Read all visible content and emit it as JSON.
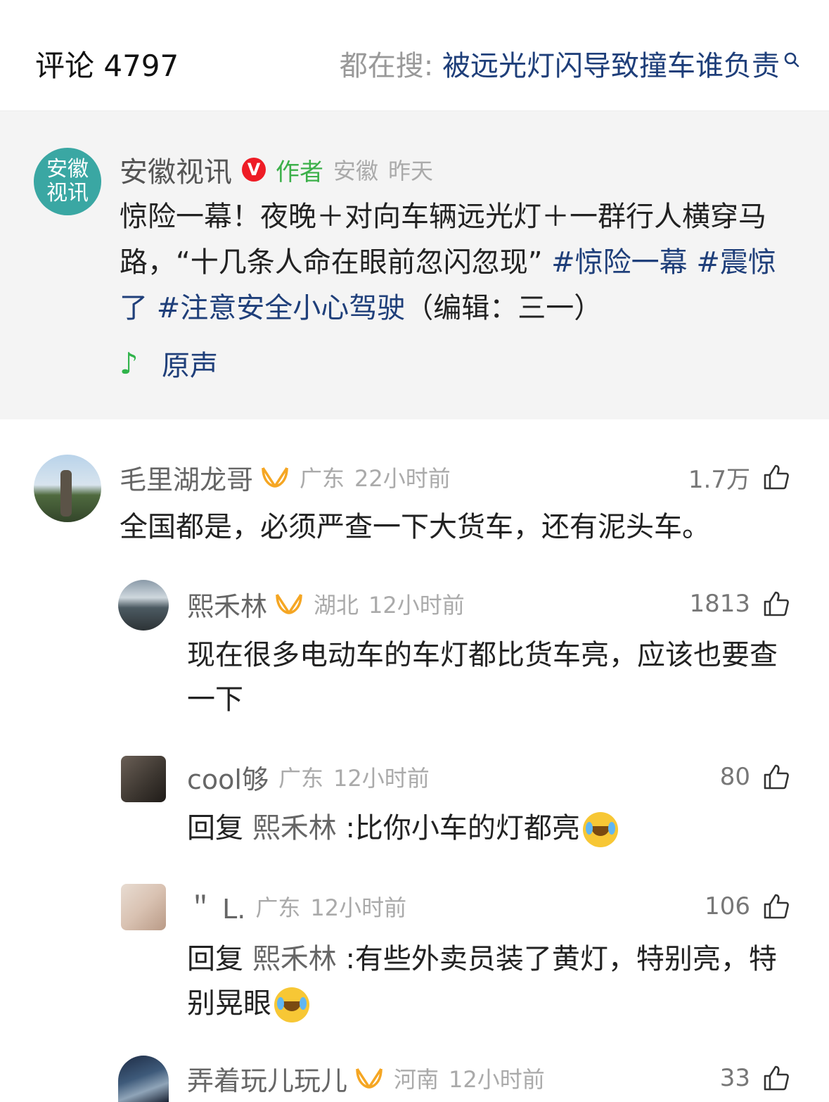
{
  "header": {
    "comment_label": "评论 4797",
    "hot_prefix": "都在搜: ",
    "hot_query": "被远光灯闪导致撞车谁负责"
  },
  "author_post": {
    "avatar_text_1": "安徽",
    "avatar_text_2": "视讯",
    "name": "安徽视讯",
    "verified_mark": "V",
    "tag": "作者",
    "location": "安徽",
    "time": "昨天",
    "text": "惊险一幕！夜晚＋对向车辆远光灯＋一群行人横穿马路，“十几条人命在眼前忽闪忽现”",
    "hashtags": [
      "#惊险一幕",
      "#震惊了",
      "#注意安全小心驾驶"
    ],
    "editor_note": "（编辑：三一）",
    "music_label": "原声"
  },
  "comments": [
    {
      "name": "毛里湖龙哥",
      "location": "广东",
      "time": "22小时前",
      "likes": "1.7万",
      "text": "全国都是，必须严查一下大货车，还有泥头车。"
    },
    {
      "name": "熙禾林",
      "location": "湖北",
      "time": "12小时前",
      "likes": "1813",
      "text": "现在很多电动车的车灯都比货车亮，应该也要查一下"
    },
    {
      "name": "cool够",
      "location": "广东",
      "time": "12小时前",
      "likes": "80",
      "reply_prefix": "回复",
      "reply_to": "熙禾林",
      "text": ":比你小车的灯都亮"
    },
    {
      "name": "＂ L.",
      "location": "广东",
      "time": "12小时前",
      "likes": "106",
      "reply_prefix": "回复",
      "reply_to": "熙禾林",
      "text": ":有些外卖员装了黄灯，特别亮，特别晃眼"
    },
    {
      "name": "弄着玩儿玩儿",
      "location": "河南",
      "time": "12小时前",
      "likes": "33"
    }
  ],
  "colors": {
    "link_blue": "#1f3f7a",
    "author_green": "#3cb04a",
    "badge_orange": "#f5a623",
    "verified_red": "#ee1c25"
  }
}
